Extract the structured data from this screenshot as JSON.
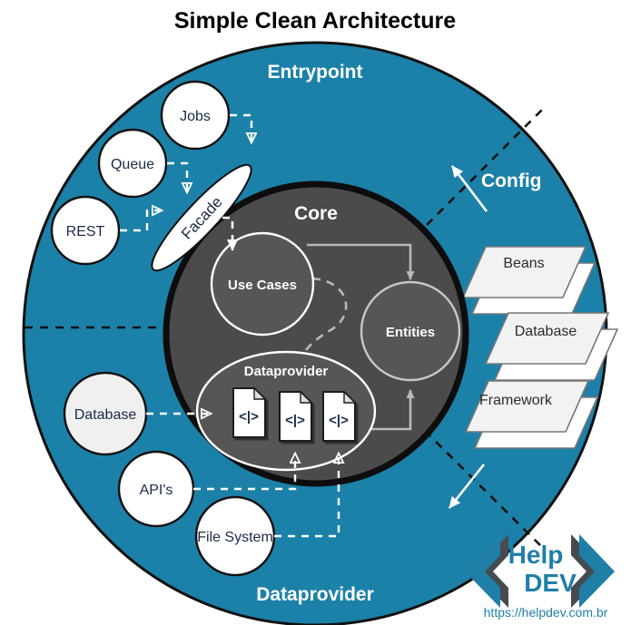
{
  "title": "Simple Clean Architecture",
  "rings": {
    "entrypoint_label": "Entrypoint",
    "dataprovider_label": "Dataprovider",
    "config_label": "Config",
    "core_label": "Core"
  },
  "colors": {
    "ring_teal": "#1c81a8",
    "core_dark": "#4b4b4b",
    "inner_circle": "#565656",
    "outline_black": "#111111",
    "white": "#ffffff",
    "node_white": "#ffffff",
    "node_offwhite": "#f0f0f0",
    "doc_face": "#f2f2f2",
    "doc_edge": "#666666",
    "logo_teal": "#1f7fa6",
    "logo_dark": "#454b50",
    "link_text": "#1f7fa6",
    "code_navy": "#1b2a4a",
    "code_orange": "#e08020"
  },
  "entrypoint_nodes": [
    {
      "name": "jobs",
      "label": "Jobs"
    },
    {
      "name": "queue",
      "label": "Queue"
    },
    {
      "name": "rest",
      "label": "REST"
    }
  ],
  "facade": {
    "label": "Facade"
  },
  "core_nodes": [
    {
      "name": "use-cases",
      "label": "Use Cases"
    },
    {
      "name": "entities",
      "label": "Entities"
    },
    {
      "name": "dataprovider",
      "label": "Dataprovider"
    }
  ],
  "code_files": [
    {
      "name": "code-file-1",
      "glyph": "<|>"
    },
    {
      "name": "code-file-2",
      "glyph": "<|>"
    },
    {
      "name": "code-file-3",
      "glyph": "<|>"
    }
  ],
  "dataprovider_nodes": [
    {
      "name": "database",
      "label": "Database"
    },
    {
      "name": "apis",
      "label": "API's"
    },
    {
      "name": "file-system",
      "label": "File System"
    }
  ],
  "config_docs": [
    {
      "name": "beans",
      "label": "Beans"
    },
    {
      "name": "database-config",
      "label": "Database"
    },
    {
      "name": "framework",
      "label": "Framework"
    }
  ],
  "logo": {
    "help": "Help",
    "dev": "DEV",
    "url": "https://helpdev.com.br"
  }
}
